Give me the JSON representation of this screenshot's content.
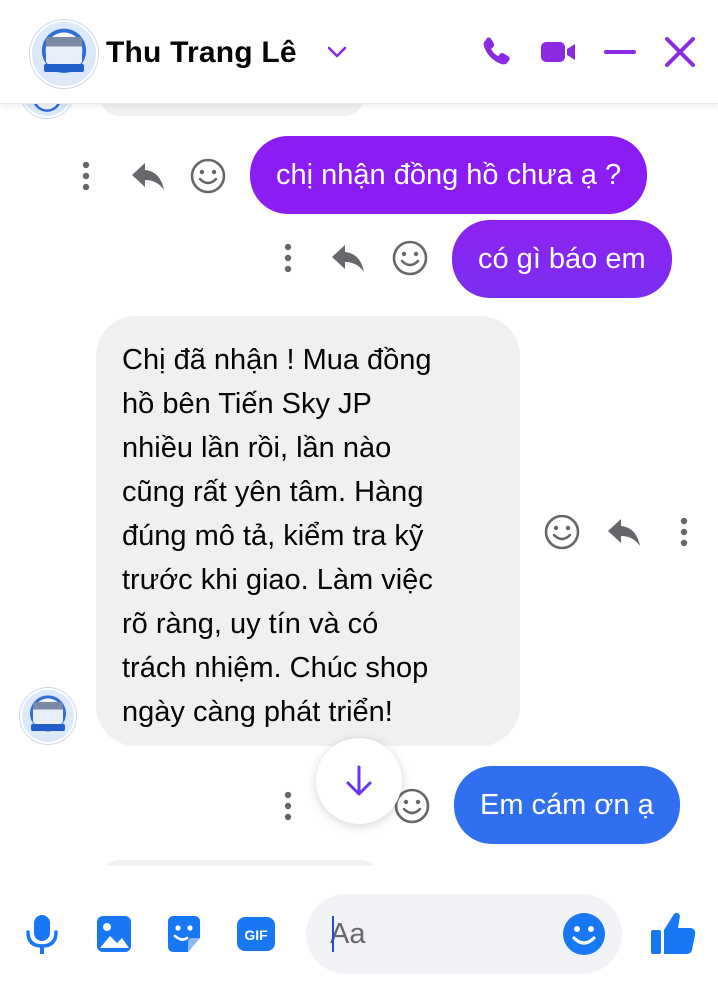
{
  "header": {
    "contact_name": "Thu Trang Lê",
    "icons": [
      "chevron-down-icon",
      "phone-icon",
      "video-camera-icon",
      "minimize-icon",
      "close-icon"
    ]
  },
  "messages": [
    {
      "direction": "outgoing",
      "text": "chị nhận đồng hồ chưa ạ ?"
    },
    {
      "direction": "outgoing",
      "text": "có gì báo em"
    },
    {
      "direction": "incoming",
      "lines": [
        "Chị đã nhận !  Mua đồng",
        "hồ bên Tiến Sky JP",
        "nhiều lần rồi, lần nào",
        "cũng rất yên tâm. Hàng",
        "đúng mô tả, kiểm tra kỹ",
        "trước khi giao. Làm việc",
        "rõ ràng, uy tín và có",
        "trách nhiệm. Chúc shop",
        "ngày càng phát triển!"
      ]
    },
    {
      "direction": "outgoing",
      "text": "Em cám ơn ạ"
    }
  ],
  "composer": {
    "placeholder": "Aa",
    "icons": [
      "microphone-icon",
      "image-icon",
      "sticker-icon",
      "gif-icon",
      "emoji-icon",
      "thumbs-up-icon"
    ]
  },
  "colors": {
    "accent": "#8b1cf3",
    "outgoing_blue": "#2f6ff0",
    "incoming_grey": "#f0f0f2",
    "icon_purple": "#8a2be2",
    "icon_blue": "#1877f2"
  }
}
